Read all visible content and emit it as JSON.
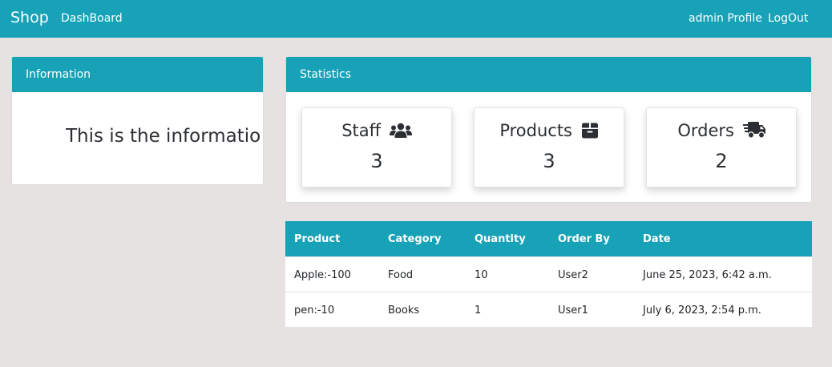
{
  "navbar": {
    "brand": "Shop",
    "dashboard": "DashBoard",
    "profile": "admin Profile",
    "logout": "LogOut",
    "color": "#17a2b8"
  },
  "information": {
    "header": "Information",
    "body": "This is the information"
  },
  "statistics": {
    "header": "Statistics",
    "items": [
      {
        "title": "Staff",
        "icon": "users-icon",
        "value": "3"
      },
      {
        "title": "Products",
        "icon": "box-icon",
        "value": "3"
      },
      {
        "title": "Orders",
        "icon": "truck-icon",
        "value": "2"
      }
    ]
  },
  "orders_table": {
    "columns": [
      "Product",
      "Category",
      "Quantity",
      "Order By",
      "Date"
    ],
    "rows": [
      [
        "Apple:-100",
        "Food",
        "10",
        "User2",
        "June 25, 2023, 6:42 a.m."
      ],
      [
        "pen:-10",
        "Books",
        "1",
        "User1",
        "July 6, 2023, 2:54 p.m."
      ]
    ]
  }
}
